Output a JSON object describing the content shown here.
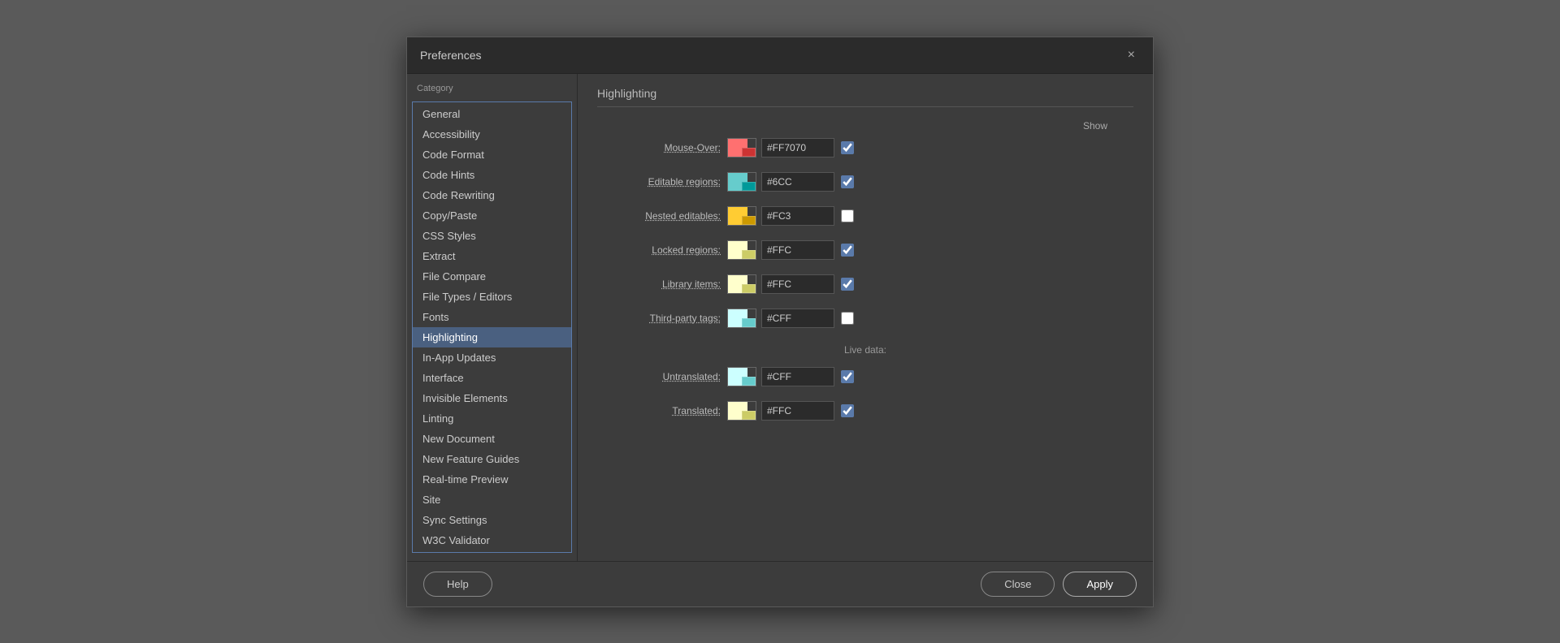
{
  "dialog": {
    "title": "Preferences",
    "close_label": "×"
  },
  "sidebar": {
    "header": "Category",
    "items": [
      {
        "label": "General",
        "active": false
      },
      {
        "label": "Accessibility",
        "active": false
      },
      {
        "label": "Code Format",
        "active": false
      },
      {
        "label": "Code Hints",
        "active": false
      },
      {
        "label": "Code Rewriting",
        "active": false
      },
      {
        "label": "Copy/Paste",
        "active": false
      },
      {
        "label": "CSS Styles",
        "active": false
      },
      {
        "label": "Extract",
        "active": false
      },
      {
        "label": "File Compare",
        "active": false
      },
      {
        "label": "File Types / Editors",
        "active": false
      },
      {
        "label": "Fonts",
        "active": false
      },
      {
        "label": "Highlighting",
        "active": true
      },
      {
        "label": "In-App Updates",
        "active": false
      },
      {
        "label": "Interface",
        "active": false
      },
      {
        "label": "Invisible Elements",
        "active": false
      },
      {
        "label": "Linting",
        "active": false
      },
      {
        "label": "New Document",
        "active": false
      },
      {
        "label": "New Feature Guides",
        "active": false
      },
      {
        "label": "Real-time Preview",
        "active": false
      },
      {
        "label": "Site",
        "active": false
      },
      {
        "label": "Sync Settings",
        "active": false
      },
      {
        "label": "W3C Validator",
        "active": false
      }
    ]
  },
  "content": {
    "header": "Highlighting",
    "show_label": "Show",
    "rows": [
      {
        "label": "Mouse-Over:",
        "swatch_color": "#FF7070",
        "swatch_overlay": "#cc3333",
        "value": "#FF7070",
        "checked": true
      },
      {
        "label": "Editable regions:",
        "swatch_color": "#66cccc",
        "swatch_overlay": "#009999",
        "value": "#6CC",
        "checked": true
      },
      {
        "label": "Nested editables:",
        "swatch_color": "#ffcc33",
        "swatch_overlay": "#cc9900",
        "value": "#FC3",
        "checked": false
      },
      {
        "label": "Locked regions:",
        "swatch_color": "#ffffcc",
        "swatch_overlay": "#cccc66",
        "value": "#FFC",
        "checked": true
      },
      {
        "label": "Library items:",
        "swatch_color": "#ffffcc",
        "swatch_overlay": "#cccc66",
        "value": "#FFC",
        "checked": true
      },
      {
        "label": "Third-party tags:",
        "swatch_color": "#ccffff",
        "swatch_overlay": "#66cccc",
        "value": "#CFF",
        "checked": false
      }
    ],
    "live_data_label": "Live data:",
    "live_rows": [
      {
        "label": "Untranslated:",
        "swatch_color": "#ccffff",
        "swatch_overlay": "#66cccc",
        "value": "#CFF",
        "checked": true
      },
      {
        "label": "Translated:",
        "swatch_color": "#ffffcc",
        "swatch_overlay": "#cccc66",
        "value": "#FFC",
        "checked": true
      }
    ]
  },
  "footer": {
    "help_label": "Help",
    "close_label": "Close",
    "apply_label": "Apply"
  }
}
